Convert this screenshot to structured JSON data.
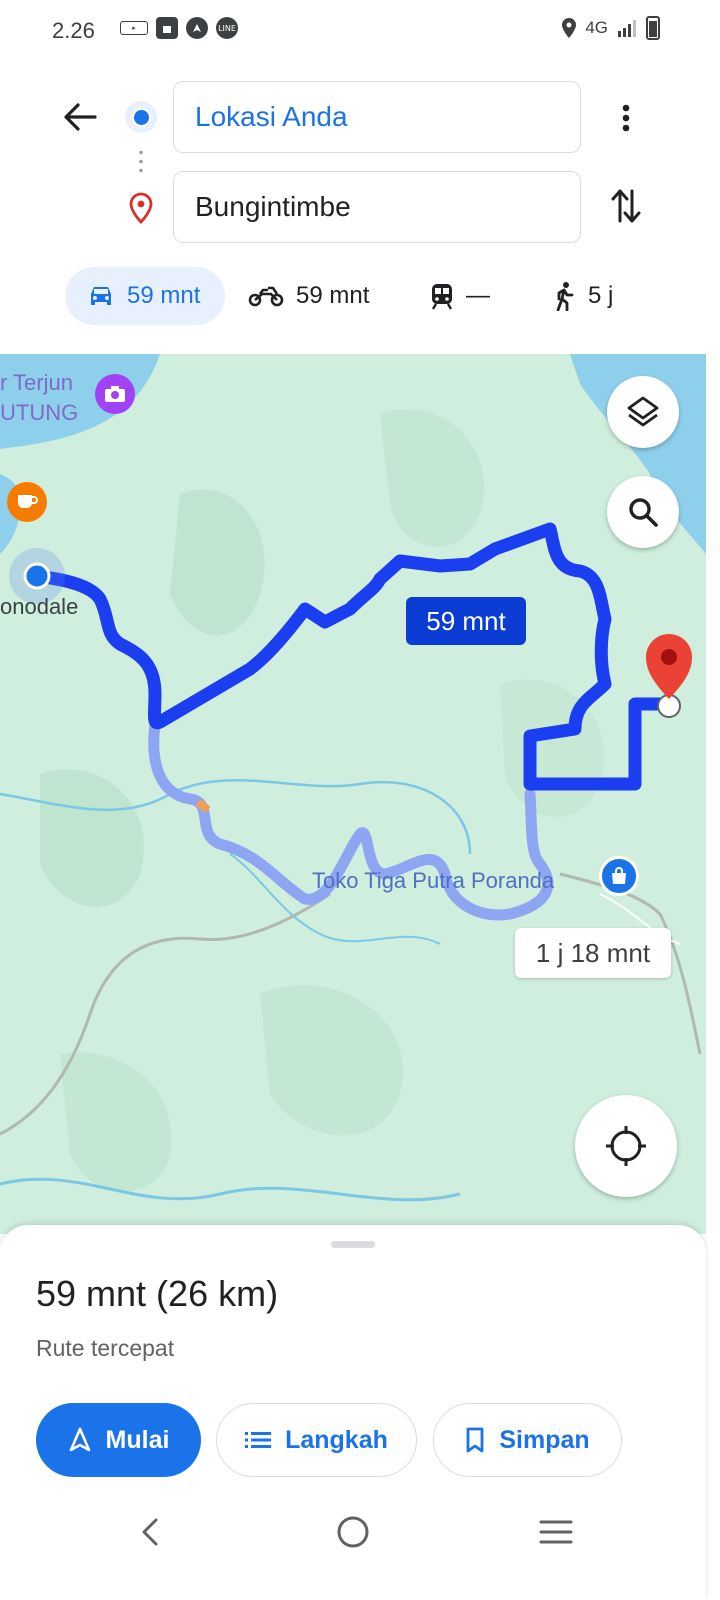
{
  "status_bar": {
    "time": "2.26",
    "network": "4G",
    "notification_icons": [
      "navigation-app-icon",
      "shopping-bag-icon",
      "browser-icon",
      "line-app-icon"
    ],
    "line_label": "LINE",
    "system_icons": [
      "location-icon",
      "signal-icon",
      "battery-icon"
    ]
  },
  "directions": {
    "origin": "Lokasi Anda",
    "destination": "Bungintimbe"
  },
  "travel_modes": [
    {
      "mode": "car",
      "icon": "car-icon",
      "label": "59 mnt",
      "selected": true
    },
    {
      "mode": "motorcycle",
      "icon": "motorcycle-icon",
      "label": "59 mnt",
      "selected": false
    },
    {
      "mode": "transit",
      "icon": "train-icon",
      "label": "—",
      "selected": false
    },
    {
      "mode": "walk",
      "icon": "walk-icon",
      "label": "5 j",
      "selected": false
    }
  ],
  "map": {
    "labels": {
      "waterfall_line1": "r Terjun",
      "waterfall_line2": "UTUNG",
      "town_partial": "onodale",
      "shop": "Toko Tiga Putra Poranda"
    },
    "route_primary_time": "59 mnt",
    "route_alternate_time": "1 j 18 mnt",
    "colors": {
      "land": "#cfeedd",
      "water": "#7fc8e8",
      "route_primary": "#1a3ef0",
      "route_alternate": "#9fb3f5",
      "pin": "#ea4335",
      "poi_purple": "#a142f4",
      "poi_orange": "#f57c00",
      "poi_blue": "#1a73e8"
    }
  },
  "sheet": {
    "summary": "59 mnt (26 km)",
    "subtitle": "Rute tercepat",
    "start_label": "Mulai",
    "steps_label": "Langkah",
    "save_label": "Simpan"
  }
}
